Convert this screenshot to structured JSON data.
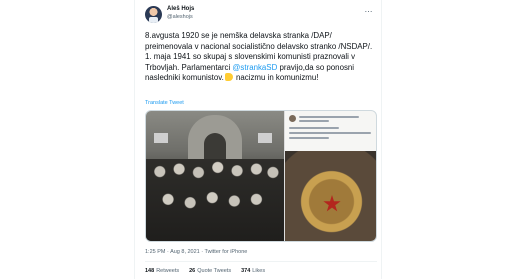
{
  "tweet": {
    "author_name": "Aleš Hojs",
    "author_handle": "@aleshojs",
    "more_icon": "⋯",
    "text_part1": "8.avgusta 1920 se je nemška delavska stranka /DAP/ preimenovala v nacional socialistično delavsko stranko /NSDAP/. 1. maja 1941 so skupaj s slovenskimi komunisti praznovali v Trbovljah. Parlamentarci ",
    "mention": "@strankaSD",
    "text_part2": " pravijo,da so ponosni nasledniki komunistov.",
    "text_part3": " nacizmu in komunizmu!",
    "translate_label": "Translate Tweet",
    "timestamp": "1:25 PM · Aug 8, 2021 · Twitter for iPhone",
    "stats": {
      "retweets_count": "148",
      "retweets_label": "Retweets",
      "quotes_count": "26",
      "quotes_label": "Quote Tweets",
      "likes_count": "374",
      "likes_label": "Likes"
    }
  },
  "colors": {
    "link": "#1d9bf0",
    "text": "#0f1419",
    "secondary": "#536471"
  },
  "icons": {
    "verified": "verified-icon",
    "emoji": "thumbs-down-emoji"
  }
}
